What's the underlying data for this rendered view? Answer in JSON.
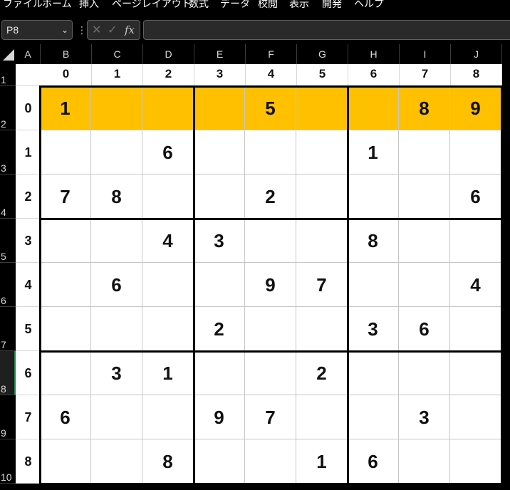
{
  "menu": [
    "ファイル",
    "ホーム",
    "挿入",
    "ページレイアウト",
    "数式",
    "データ",
    "校閲",
    "表示",
    "開発",
    "ヘルプ"
  ],
  "name_box": {
    "value": "P8",
    "dropdown_icon": "chevron-down-icon"
  },
  "formula_bar": {
    "separator": "⋮",
    "cancel_icon": "✕",
    "enter_icon": "✓",
    "function_icon": "fx",
    "value": ""
  },
  "columns": [
    "A",
    "B",
    "C",
    "D",
    "E",
    "F",
    "G",
    "H",
    "I",
    "J"
  ],
  "rows": [
    "1",
    "2",
    "3",
    "4",
    "5",
    "6",
    "7",
    "8",
    "9",
    "10"
  ],
  "active_row": "8",
  "sheet": {
    "col_index_labels": [
      "0",
      "1",
      "2",
      "3",
      "4",
      "5",
      "6",
      "7",
      "8"
    ],
    "row_index_labels": [
      "0",
      "1",
      "2",
      "3",
      "4",
      "5",
      "6",
      "7",
      "8"
    ],
    "highlight_row": 0,
    "highlight_color": "#ffc000",
    "grid": [
      [
        "1",
        "",
        "",
        "",
        "5",
        "",
        "",
        "8",
        "9"
      ],
      [
        "",
        "",
        "6",
        "",
        "",
        "",
        "1",
        "",
        ""
      ],
      [
        "7",
        "8",
        "",
        "",
        "2",
        "",
        "",
        "",
        "6"
      ],
      [
        "",
        "",
        "4",
        "3",
        "",
        "",
        "8",
        "",
        ""
      ],
      [
        "",
        "6",
        "",
        "",
        "9",
        "7",
        "",
        "",
        "4"
      ],
      [
        "",
        "",
        "",
        "2",
        "",
        "",
        "3",
        "6",
        ""
      ],
      [
        "",
        "3",
        "1",
        "",
        "",
        "2",
        "",
        "",
        ""
      ],
      [
        "6",
        "",
        "",
        "9",
        "7",
        "",
        "",
        "3",
        ""
      ],
      [
        "",
        "",
        "8",
        "",
        "",
        "1",
        "6",
        "",
        ""
      ]
    ]
  }
}
